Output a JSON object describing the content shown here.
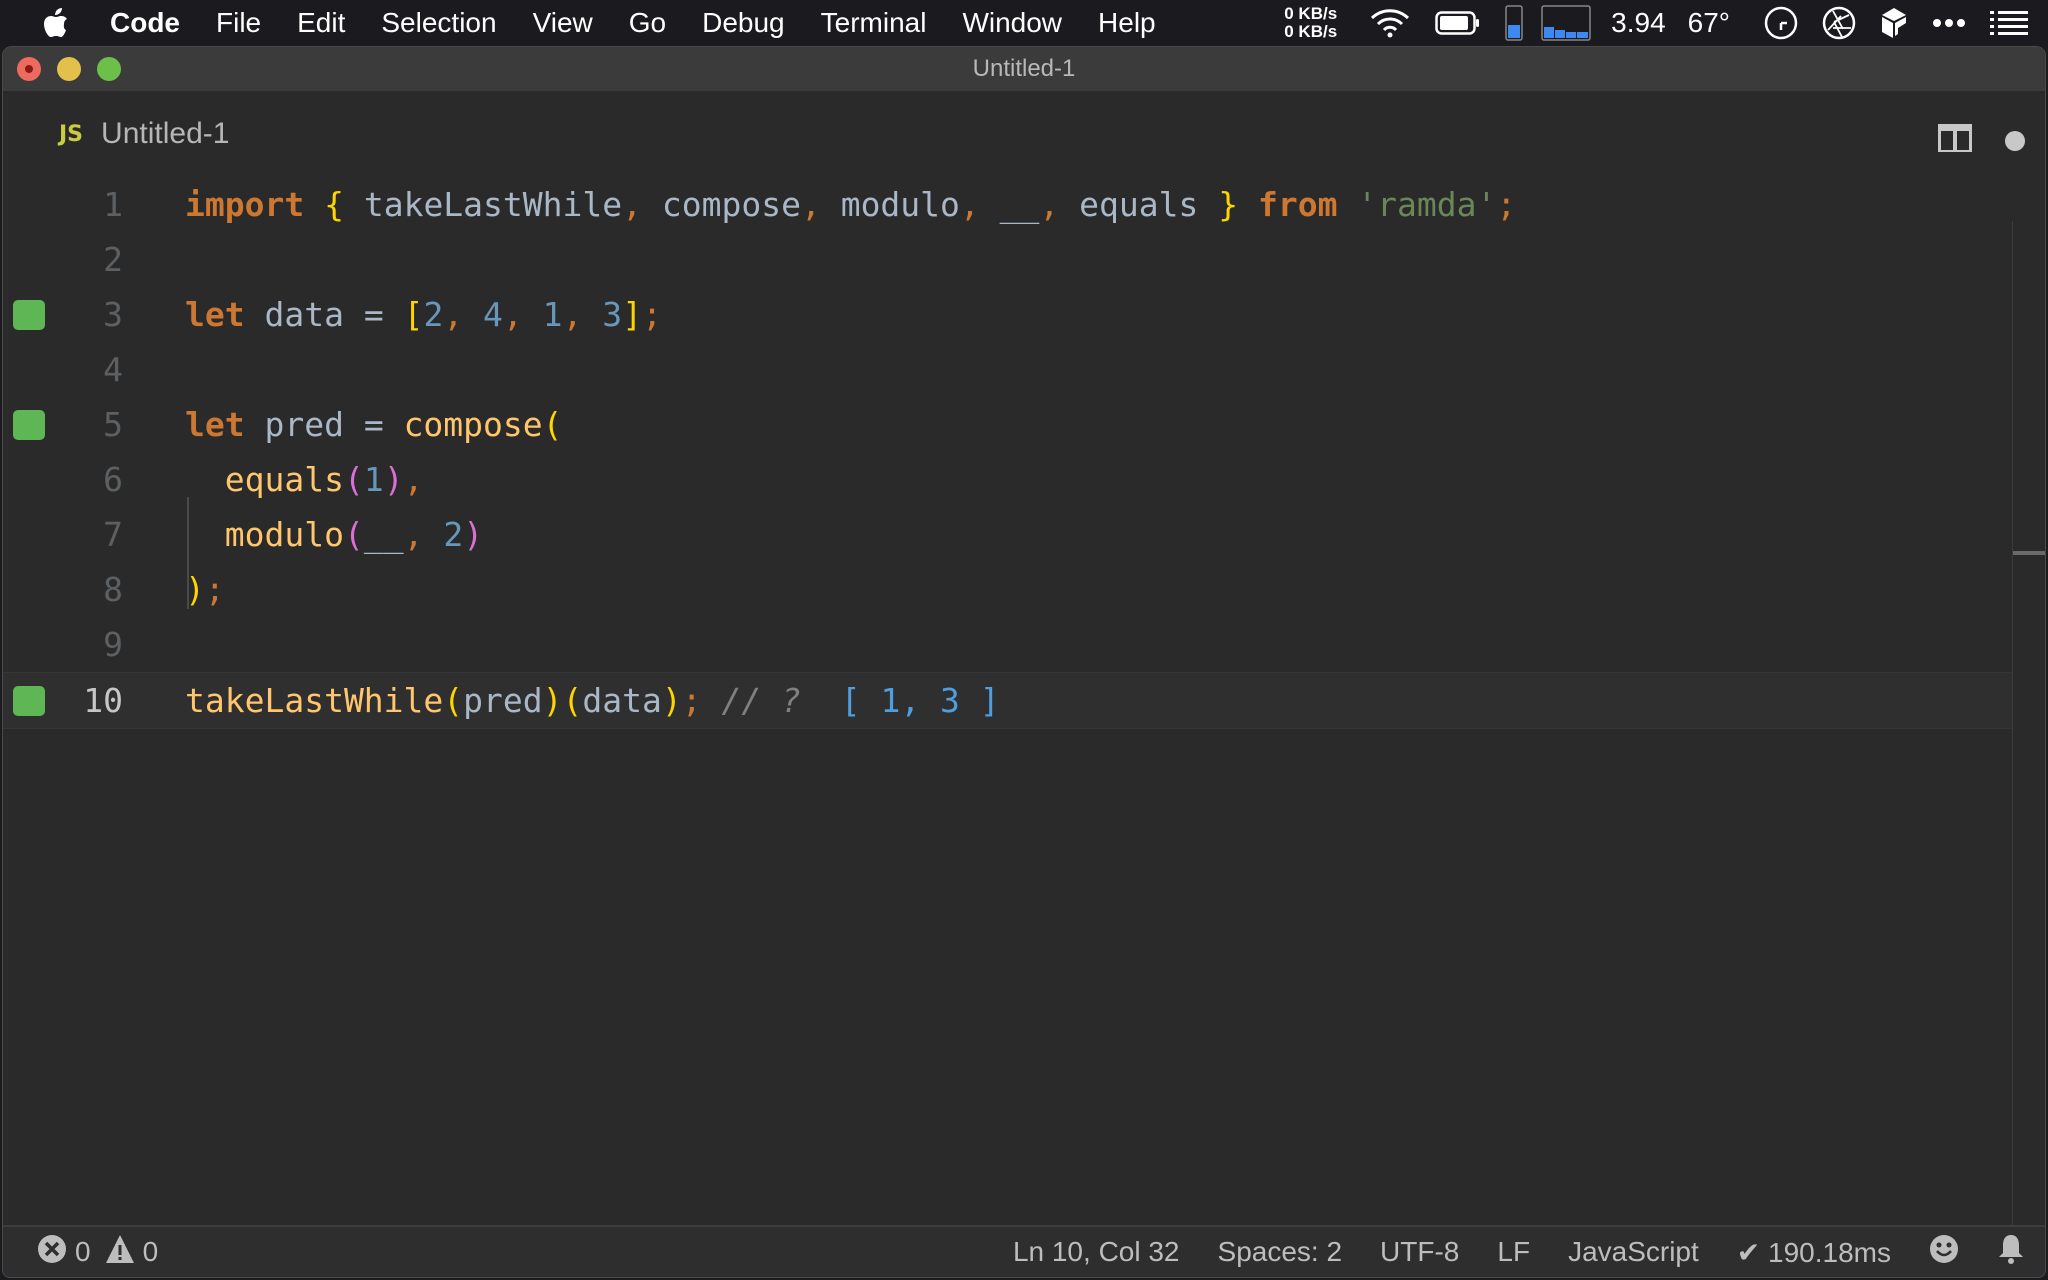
{
  "menubar": {
    "app_name": "Code",
    "items": [
      "File",
      "Edit",
      "Selection",
      "View",
      "Go",
      "Debug",
      "Terminal",
      "Window",
      "Help"
    ],
    "tray": {
      "net_up": "0 KB/s",
      "net_down": "0 KB/s",
      "load": "3.94",
      "temperature": "67°",
      "icons": [
        "wifi-icon",
        "battery-icon",
        "memory-gauge-icon",
        "cpu-graph-icon",
        "clock-icon",
        "aperture-icon",
        "box-icon",
        "more-icon",
        "list-icon"
      ]
    }
  },
  "window": {
    "title": "Untitled-1"
  },
  "tab": {
    "lang_badge": "JS",
    "name": "Untitled-1",
    "unsaved": true
  },
  "editor": {
    "current_line": 10,
    "lines": [
      {
        "n": "1",
        "marker": false
      },
      {
        "n": "2",
        "marker": false
      },
      {
        "n": "3",
        "marker": true
      },
      {
        "n": "4",
        "marker": false
      },
      {
        "n": "5",
        "marker": true
      },
      {
        "n": "6",
        "marker": false
      },
      {
        "n": "7",
        "marker": false
      },
      {
        "n": "8",
        "marker": false
      },
      {
        "n": "9",
        "marker": false
      },
      {
        "n": "10",
        "marker": true
      }
    ],
    "tokens": {
      "l1": [
        "import",
        "{",
        " takeLastWhile",
        ",",
        " compose",
        ",",
        " modulo",
        ",",
        " __",
        ",",
        " equals ",
        "}",
        " from",
        " 'ramda'",
        ";"
      ],
      "l3": [
        "let",
        " data = ",
        "[",
        "2",
        ",",
        " 4",
        ",",
        " 1",
        ",",
        " 3",
        "]",
        ";"
      ],
      "l5": [
        "let",
        " pred = ",
        "compose",
        "("
      ],
      "l6": [
        "  equals",
        "(",
        "1",
        ")",
        ","
      ],
      "l7": [
        "  modulo",
        "(",
        "__",
        ",",
        " 2",
        ")"
      ],
      "l8": [
        ")",
        ";"
      ],
      "l10": [
        "takeLastWhile",
        "(",
        "pred",
        ")",
        "(",
        "data",
        ")",
        ";",
        " // ? ",
        " [ 1, 3 ]"
      ]
    }
  },
  "statusbar": {
    "errors": "0",
    "warnings": "0",
    "position": "Ln 10, Col 32",
    "indent": "Spaces: 2",
    "encoding": "UTF-8",
    "eol": "LF",
    "language": "JavaScript",
    "timing": "✔ 190.18ms"
  },
  "colors": {
    "keyword": "#cc7832",
    "function": "#ffc66d",
    "number": "#6897bb",
    "string": "#6a8759",
    "bracket1": "#ffd500",
    "bracket2": "#da70d6",
    "gutter_marker": "#5fb655",
    "result": "#4e9ee0"
  }
}
